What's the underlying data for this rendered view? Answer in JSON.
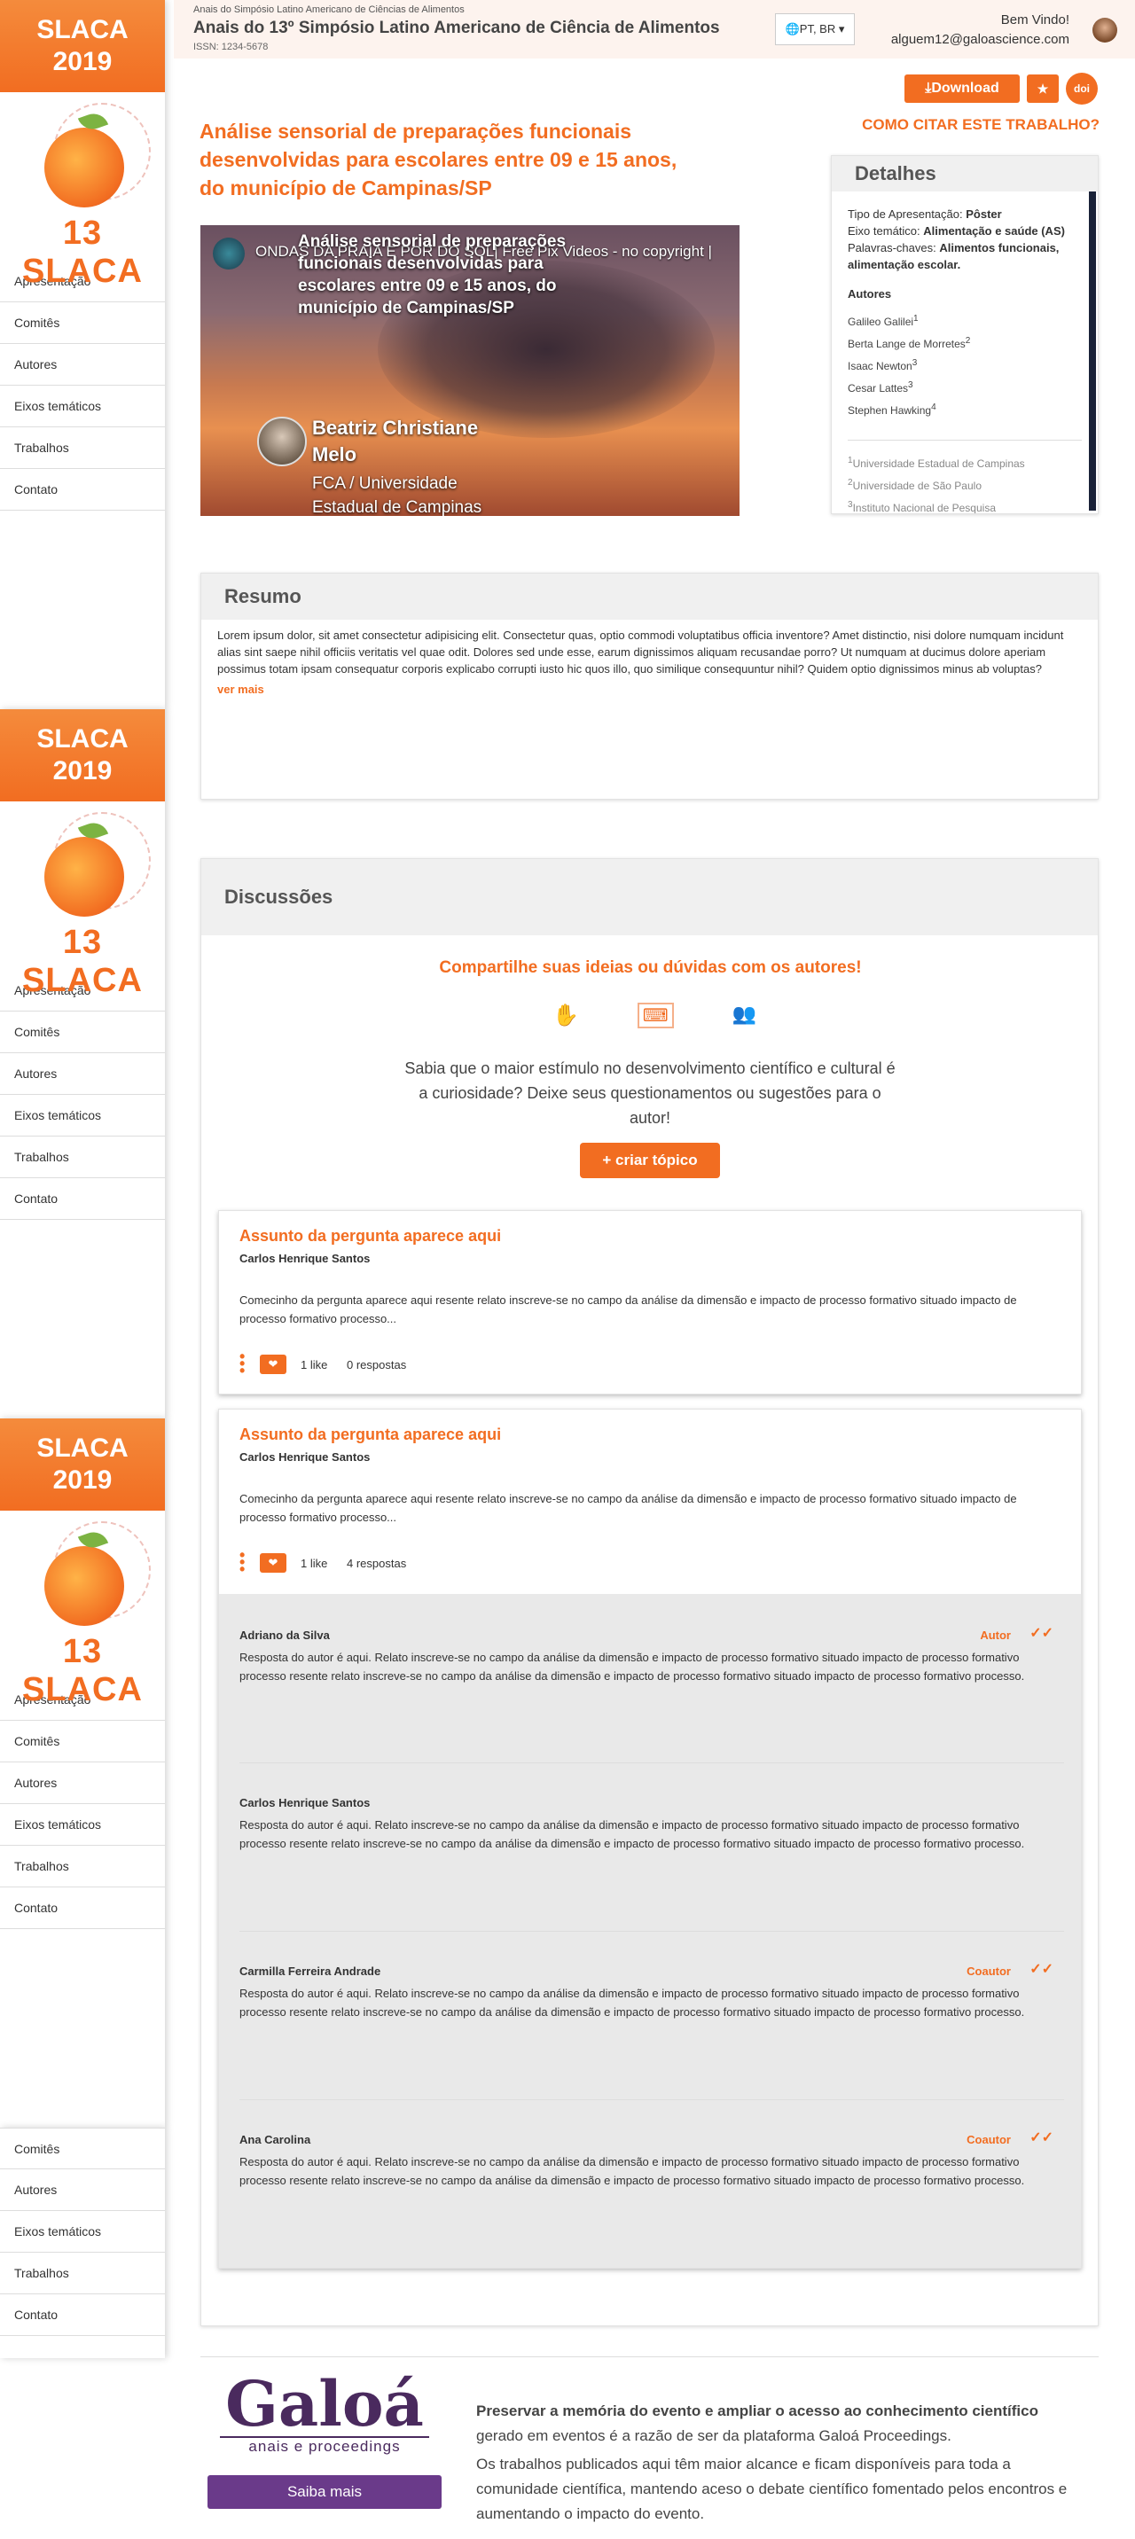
{
  "sidebar": {
    "badge_line1": "SLACA",
    "badge_line2": "2019",
    "logo_text": "13 SLACA",
    "items": [
      {
        "label": "Apresentação"
      },
      {
        "label": "Comitês"
      },
      {
        "label": "Autores"
      },
      {
        "label": "Eixos temáticos"
      },
      {
        "label": "Trabalhos"
      },
      {
        "label": "Contato"
      }
    ]
  },
  "header": {
    "supertitle": "Anais do Simpósio Latino Americano de Ciências de Alimentos",
    "title": "Anais do 13º Simpósio Latino Americano de Ciência de Alimentos",
    "issn": "ISSN: 1234-5678",
    "lang": "PT, BR",
    "welcome": "Bem Vindo!",
    "email": "alguem12@galoascience.com"
  },
  "actions": {
    "download": "Download",
    "how_to_cite": "COMO CITAR ESTE TRABALHO?",
    "doi": "doi"
  },
  "paper": {
    "title": "Análise sensorial de preparações funcionais desenvolvidas para escolares entre 09 e 15 anos, do município de Campinas/SP"
  },
  "video": {
    "channel_title": "ONDAS DA PRAIA E POR DO SOL| Free Pix Videos - no copyright |",
    "slide_title": "Análise sensorial de preparações funcionais desenvolvidas para escolares entre 09 e 15 anos, do município de Campinas/SP",
    "presenter": "Beatriz Christiane Melo",
    "affiliation": "FCA / Universidade Estadual de Campinas"
  },
  "details": {
    "heading": "Detalhes",
    "presentation_label": "Tipo de Apresentação:",
    "presentation_value": "Pôster",
    "axis_label": "Eixo temático:",
    "axis_value": "Alimentação e saúde (AS)",
    "keywords_label": "Palavras-chaves:",
    "keywords_value": "Alimentos funcionais, alimentação escolar.",
    "authors_heading": "Autores",
    "authors": [
      {
        "name": "Galileo Galilei",
        "sup": "1"
      },
      {
        "name": "Berta Lange de Morretes",
        "sup": "2"
      },
      {
        "name": "Isaac Newton",
        "sup": "3"
      },
      {
        "name": "Cesar Lattes",
        "sup": "3"
      },
      {
        "name": "Stephen Hawking",
        "sup": "4"
      }
    ],
    "affiliations": [
      {
        "sup": "1",
        "name": "Universidade Estadual de Campinas"
      },
      {
        "sup": "2",
        "name": "Universidade de São Paulo"
      },
      {
        "sup": "3",
        "name": "Instituto Nacional de Pesquisa"
      }
    ]
  },
  "abstract": {
    "heading": "Resumo",
    "text": "Lorem ipsum dolor, sit amet consectetur adipisicing elit. Consectetur quas, optio commodi voluptatibus officia inventore? Amet distinctio, nisi dolore numquam incidunt alias sint saepe nihil officiis veritatis vel quae odit. Dolores sed unde esse, earum dignissimos aliquam recusandae porro? Ut numquam at ducimus dolore aperiam possimus totam ipsam consequatur corporis explicabo corrupti iusto hic quos illo, quo similique consequuntur nihil? Quidem optio dignissimos minus ab voluptas?",
    "more": "ver mais"
  },
  "discussions": {
    "heading": "Discussões",
    "share_title": "Compartilhe suas ideias ou dúvidas com os autores!",
    "share_text": "Sabia que o maior estímulo no desenvolvimento científico e cultural é a curiosidade? Deixe seus questionamentos ou sugestões para o autor!",
    "create_topic": "+ criar tópico",
    "topics": [
      {
        "title": "Assunto da pergunta aparece aqui",
        "author": "Carlos Henrique Santos",
        "excerpt": "Comecinho da pergunta aparece aqui resente relato inscreve-se no campo da análise da dimensão e impacto de processo formativo situado impacto de processo formativo processo...",
        "likes": "1 like",
        "replies": "0 respostas"
      },
      {
        "title": "Assunto da pergunta aparece aqui",
        "author": "Carlos Henrique Santos",
        "excerpt": "Comecinho da pergunta aparece aqui resente relato inscreve-se no campo da análise da dimensão e impacto de processo formativo situado impacto de processo formativo processo...",
        "likes": "1 like",
        "replies": "4 respostas"
      }
    ],
    "replies": [
      {
        "name": "Adriano da Silva",
        "role": "Autor",
        "text": "Resposta do autor é aqui. Relato inscreve-se no campo da análise da dimensão e impacto de processo formativo situado impacto de processo formativo processo resente relato inscreve-se no campo da análise da dimensão e impacto de processo formativo situado impacto de processo formativo processo."
      },
      {
        "name": "Carlos Henrique Santos",
        "role": "",
        "text": "Resposta do autor é aqui. Relato inscreve-se no campo da análise da dimensão e impacto de processo formativo situado impacto de processo formativo processo resente relato inscreve-se no campo da análise da dimensão e impacto de processo formativo situado impacto de processo formativo processo."
      },
      {
        "name": "Carmilla Ferreira Andrade",
        "role": "Coautor",
        "text": "Resposta do autor é aqui. Relato inscreve-se no campo da análise da dimensão e impacto de processo formativo situado impacto de processo formativo processo resente relato inscreve-se no campo da análise da dimensão e impacto de processo formativo situado impacto de processo formativo processo."
      },
      {
        "name": "Ana Carolina",
        "role": "Coautor",
        "text": "Resposta do autor é aqui. Relato inscreve-se no campo da análise da dimensão e impacto de processo formativo situado impacto de processo formativo processo resente relato inscreve-se no campo da análise da dimensão e impacto de processo formativo situado impacto de processo formativo processo."
      }
    ]
  },
  "footer": {
    "brand": "Galoá",
    "brand_sub": "anais e proceedings",
    "cta": "Saiba mais",
    "headline": "Preservar a memória do evento e ampliar o acesso ao conhecimento científico",
    "line1": "gerado em eventos é a razão de ser da plataforma Galoá Proceedings.",
    "line2": "Os trabalhos publicados aqui têm maior alcance e ficam disponíveis para toda a comunidade científica, mantendo aceso o debate científico fomentado pelos encontros e aumentando o impacto do evento."
  },
  "colors": {
    "accent": "#f26d21",
    "brand_purple": "#4a2a5e"
  }
}
